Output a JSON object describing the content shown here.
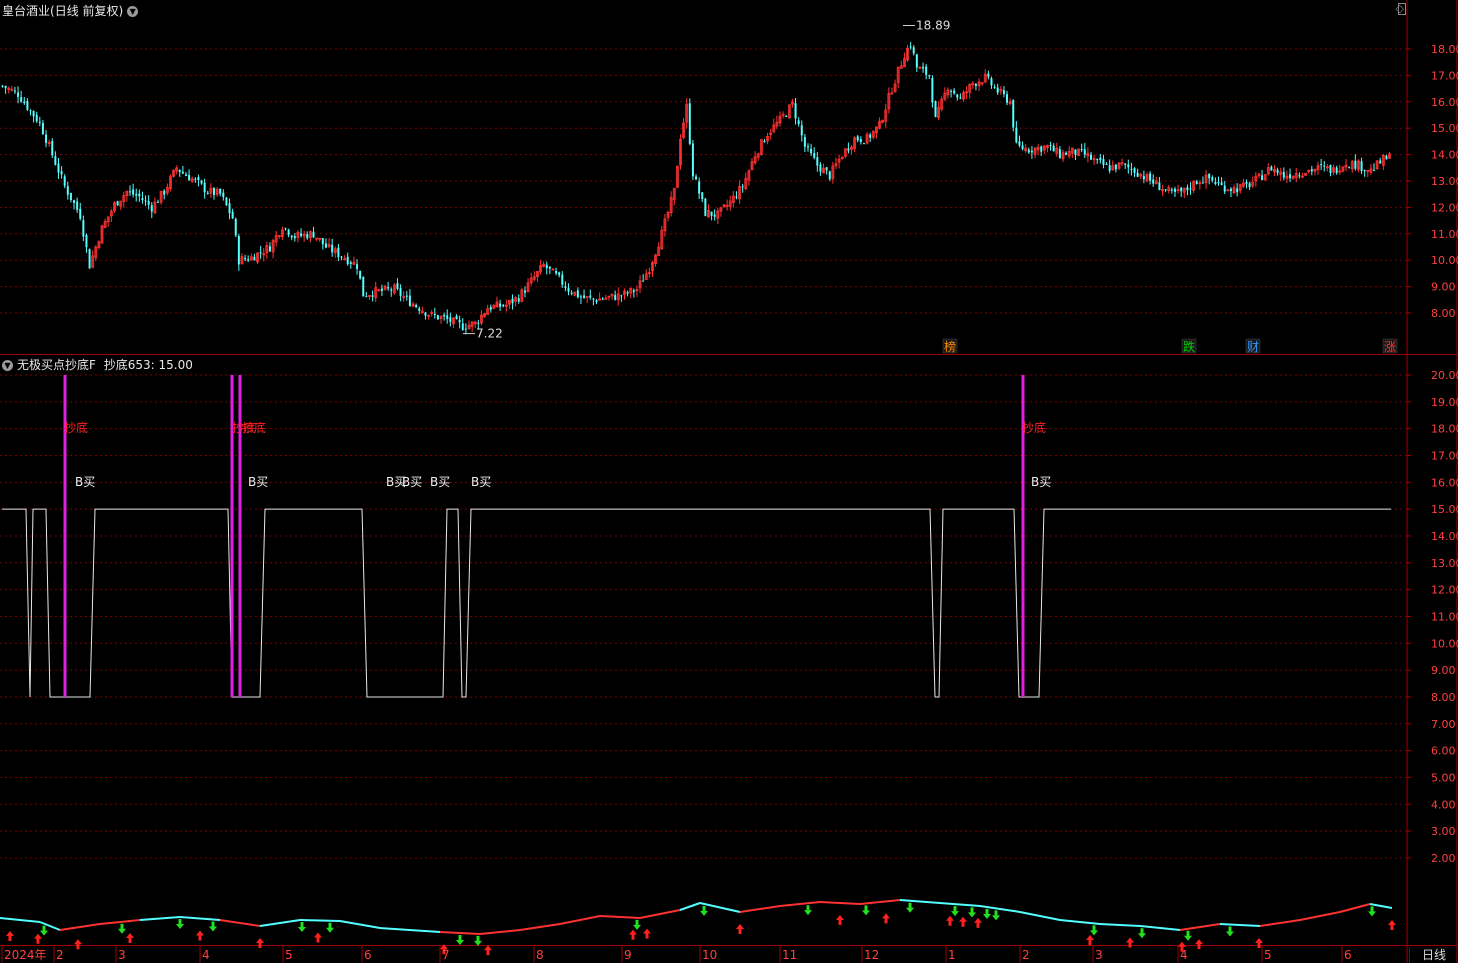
{
  "title": {
    "stock": "皇台酒业",
    "mode": "(日线 前复权)"
  },
  "indicator": {
    "name": "无极买点抄底F",
    "value_label": "抄底653: 15.00"
  },
  "price_axis": [
    "18.00",
    "17.00",
    "16.00",
    "15.00",
    "14.00",
    "13.00",
    "12.00",
    "11.00",
    "10.00",
    "9.00",
    "8.00"
  ],
  "indicator_axis": [
    "20.00",
    "19.00",
    "18.00",
    "17.00",
    "16.00",
    "15.00",
    "14.00",
    "13.00",
    "12.00",
    "11.00",
    "10.00",
    "9.00",
    "8.00",
    "7.00",
    "6.00",
    "5.00",
    "4.00",
    "3.00",
    "2.00"
  ],
  "high_marker": "18.89",
  "low_marker": "7.22",
  "event_tags": [
    {
      "text": "榜",
      "color": "#ff8c00"
    },
    {
      "text": "跌",
      "color": "#00cc00"
    },
    {
      "text": "财",
      "color": "#3399ff"
    },
    {
      "text": "涨",
      "color": "#ff3030"
    }
  ],
  "signal_labels": {
    "bottom": "抄底",
    "buy": "B买"
  },
  "date_axis": [
    "2024年",
    "2",
    "3",
    "4",
    "5",
    "6",
    "7",
    "8",
    "9",
    "10",
    "11",
    "12",
    "1",
    "2",
    "3",
    "4",
    "5",
    "6"
  ],
  "period_tab": "日线",
  "colors": {
    "up": "#ff3232",
    "down": "#54ffff",
    "grid": "#7a0000",
    "axis_text": "#ff4040",
    "magenta": "#e020e0",
    "flag_red": "#ff2020",
    "flag_green": "#20e020"
  },
  "chart_data": {
    "type": "candlestick",
    "price_range": [
      7.22,
      18.89
    ],
    "close_path": [
      [
        0,
        16.6
      ],
      [
        5,
        16.3
      ],
      [
        10,
        15.5
      ],
      [
        12,
        15.2
      ],
      [
        20,
        12.8
      ],
      [
        25,
        11.7
      ],
      [
        28,
        9.8
      ],
      [
        32,
        11.2
      ],
      [
        36,
        12.1
      ],
      [
        40,
        12.6
      ],
      [
        44,
        12.4
      ],
      [
        48,
        12.0
      ],
      [
        52,
        12.6
      ],
      [
        56,
        13.5
      ],
      [
        58,
        13.3
      ],
      [
        62,
        13.0
      ],
      [
        66,
        12.6
      ],
      [
        70,
        12.5
      ],
      [
        74,
        11.6
      ],
      [
        76,
        10.0
      ],
      [
        80,
        10.1
      ],
      [
        86,
        10.5
      ],
      [
        90,
        11.3
      ],
      [
        94,
        10.9
      ],
      [
        100,
        11.0
      ],
      [
        104,
        10.5
      ],
      [
        110,
        10.1
      ],
      [
        114,
        9.8
      ],
      [
        116,
        8.7
      ],
      [
        120,
        8.8
      ],
      [
        126,
        8.9
      ],
      [
        130,
        8.5
      ],
      [
        134,
        8.2
      ],
      [
        138,
        7.9
      ],
      [
        142,
        7.8
      ],
      [
        148,
        7.5
      ],
      [
        152,
        7.6
      ],
      [
        156,
        8.2
      ],
      [
        162,
        8.3
      ],
      [
        166,
        8.6
      ],
      [
        170,
        9.2
      ],
      [
        174,
        9.8
      ],
      [
        178,
        9.4
      ],
      [
        182,
        8.9
      ],
      [
        186,
        8.6
      ],
      [
        190,
        8.5
      ],
      [
        196,
        8.6
      ],
      [
        200,
        8.7
      ],
      [
        204,
        8.9
      ],
      [
        208,
        9.7
      ],
      [
        212,
        11.0
      ],
      [
        216,
        12.6
      ],
      [
        218,
        14.7
      ],
      [
        220,
        15.8
      ],
      [
        222,
        13.3
      ],
      [
        226,
        11.8
      ],
      [
        230,
        11.7
      ],
      [
        234,
        12.2
      ],
      [
        238,
        12.8
      ],
      [
        242,
        14.0
      ],
      [
        246,
        14.8
      ],
      [
        250,
        15.3
      ],
      [
        254,
        15.9
      ],
      [
        258,
        14.3
      ],
      [
        262,
        13.6
      ],
      [
        266,
        13.2
      ],
      [
        270,
        14.0
      ],
      [
        274,
        14.6
      ],
      [
        278,
        14.6
      ],
      [
        282,
        15.1
      ],
      [
        286,
        16.5
      ],
      [
        290,
        17.8
      ],
      [
        292,
        18.2
      ],
      [
        294,
        17.3
      ],
      [
        298,
        17.0
      ],
      [
        300,
        15.3
      ],
      [
        304,
        16.6
      ],
      [
        308,
        16.1
      ],
      [
        312,
        16.7
      ],
      [
        316,
        16.9
      ],
      [
        320,
        16.4
      ],
      [
        324,
        16.0
      ],
      [
        326,
        14.3
      ],
      [
        330,
        14.2
      ],
      [
        336,
        14.3
      ],
      [
        340,
        14.0
      ],
      [
        344,
        14.1
      ],
      [
        348,
        14.0
      ],
      [
        352,
        13.7
      ],
      [
        356,
        13.5
      ],
      [
        360,
        13.6
      ],
      [
        364,
        13.4
      ],
      [
        368,
        13.1
      ],
      [
        372,
        12.8
      ],
      [
        376,
        12.5
      ],
      [
        380,
        12.6
      ],
      [
        384,
        13.0
      ],
      [
        388,
        13.1
      ],
      [
        392,
        12.8
      ],
      [
        396,
        12.7
      ],
      [
        400,
        12.8
      ],
      [
        404,
        13.1
      ],
      [
        408,
        13.5
      ],
      [
        412,
        13.2
      ],
      [
        416,
        13.3
      ],
      [
        420,
        13.4
      ],
      [
        424,
        13.5
      ],
      [
        428,
        13.4
      ],
      [
        432,
        13.7
      ],
      [
        436,
        13.6
      ],
      [
        440,
        13.4
      ],
      [
        444,
        13.8
      ],
      [
        446,
        13.9
      ]
    ]
  }
}
